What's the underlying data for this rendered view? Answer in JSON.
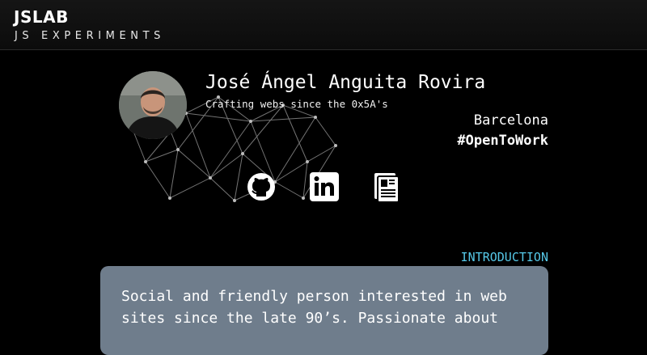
{
  "header": {
    "title": "JSLAB",
    "subtitle": "JS EXPERIMENTS"
  },
  "profile": {
    "name": "José Ángel Anguita Rovira",
    "tagline": "Crafting webs since the 0x5A's",
    "location": "Barcelona",
    "status": "#OpenToWork"
  },
  "social": [
    {
      "icon": "github-icon"
    },
    {
      "icon": "linkedin-icon"
    },
    {
      "icon": "cv-document-icon"
    }
  ],
  "introduction": {
    "label": "INTRODUCTION",
    "text": "Social and friendly person interested in web sites since the late 90’s. Passionate about"
  },
  "colors": {
    "background": "#000000",
    "accent": "#56c8e8",
    "card": "#6f7d8c"
  }
}
